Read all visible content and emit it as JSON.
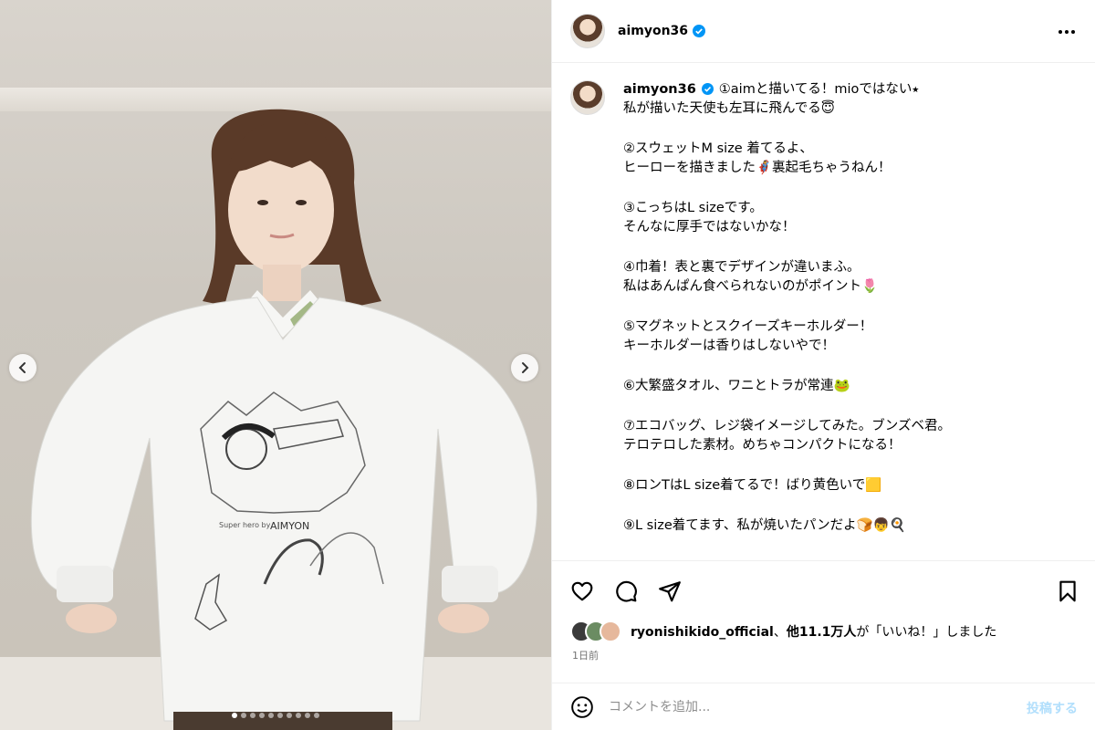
{
  "post": {
    "username": "aimyon36",
    "verified": true
  },
  "caption": {
    "lines": [
      "①aimと描いてる！mioではない⭑",
      "私が描いた天使も左耳に飛んでる😇",
      "②スウェットM size 着てるよ、",
      "ヒーローを描きました🦸‍♀️裏起毛ちゃうねん！",
      "③こっちはL sizeです。",
      "そんなに厚手ではないかな！",
      "④巾着！表と裏でデザインが違いまふ。",
      "私はあんぱん食べられないのがポイント🌷",
      "⑤マグネットとスクイーズキーホルダー！",
      "キーホルダーは香りはしないやで！",
      "⑥大繁盛タオル、ワニとトラが常連🐸",
      "⑦エコバッグ、レジ袋イメージしてみた。ブンズベ君。",
      "テロテロした素材。めちゃコンパクトになる！",
      "⑧ロンTはL size着てるで！ばり黄色いで🟨",
      "⑨L size着てます、私が焼いたパンだよ🍞👦🍳"
    ]
  },
  "likes": {
    "user": "ryonishikido_official",
    "others": "他11.1万人",
    "suffix_a": "が「いいね！」しました"
  },
  "time_ago": "1日前",
  "comment": {
    "placeholder": "コメントを追加...",
    "post_label": "投稿する"
  },
  "carousel": {
    "total": 10,
    "active": 1
  },
  "icons": {
    "like": "heart-icon",
    "comment": "speech-bubble-icon",
    "share": "paper-plane-icon",
    "save": "bookmark-icon",
    "emoji": "smiley-icon",
    "more": "more-dots-icon",
    "prev": "chevron-left-icon",
    "next": "chevron-right-icon"
  },
  "colors": {
    "verified": "#0095f6",
    "post_button": "#b2dffc",
    "muted_text": "#737373"
  }
}
